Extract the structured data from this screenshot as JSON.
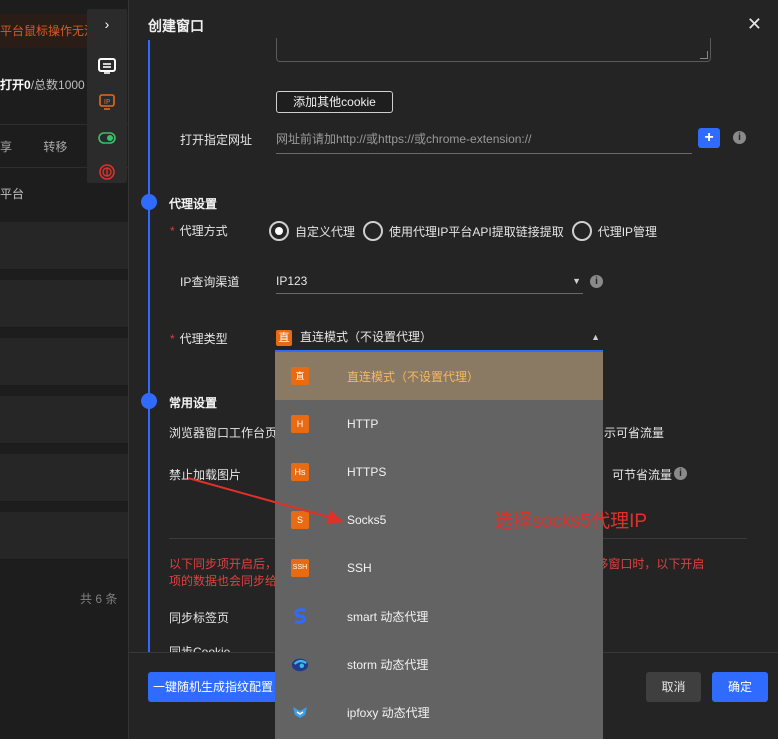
{
  "background": {
    "warning_text": "平台鼠标操作无法",
    "stats_open": "打开0",
    "stats_total": "/总数1000",
    "tabs": [
      "享",
      "转移"
    ],
    "column_head": "平台",
    "total_rows": "共 6 条"
  },
  "modal": {
    "title": "创建窗口",
    "add_cookie_button": "添加其他cookie",
    "open_url_label": "打开指定网址",
    "open_url_placeholder": "网址前请加http://或https://或chrome-extension://",
    "proxy_section_title": "代理设置",
    "proxy_mode_label": "代理方式",
    "proxy_modes": [
      "自定义代理",
      "使用代理IP平台API提取链接提取",
      "代理IP管理"
    ],
    "ip_channel_label": "IP查询渠道",
    "ip_channel_value": "IP123",
    "proxy_type_label": "代理类型",
    "proxy_type_badge": "直",
    "proxy_type_value": "直连模式（不设置代理）",
    "common_section_title": "常用设置",
    "workbench_label": "浏览器窗口工作台页",
    "workbench_suffix": "示可省流量",
    "disable_images_label": "禁止加载图片",
    "disable_images_suffix": "可节省流量",
    "warning_line1": "以下同步项开启后，",
    "warning_line1_suffix": "享/转移窗口时，以下开启",
    "warning_line2": "项的数据也会同步给",
    "sync_tabs_label": "同步标签页",
    "sync_cookie_label": "同步Cookie",
    "random_fingerprint_button": "一键随机生成指纹配置",
    "cancel_button": "取消",
    "confirm_button": "确定"
  },
  "dropdown": {
    "options": [
      {
        "icon": "直",
        "label": "直连模式（不设置代理）"
      },
      {
        "icon": "H",
        "label": "HTTP"
      },
      {
        "icon": "Hs",
        "label": "HTTPS"
      },
      {
        "icon": "S",
        "label": "Socks5"
      },
      {
        "icon": "SSH",
        "label": "SSH"
      },
      {
        "icon": "smart-icon",
        "label": "smart 动态代理"
      },
      {
        "icon": "storm-icon",
        "label": "storm 动态代理"
      },
      {
        "icon": "ipfoxy-icon",
        "label": "ipfoxy 动态代理"
      }
    ],
    "selected_index": 0
  },
  "annotation": {
    "text": "选择socks5代理IP",
    "color": "#e0302a"
  },
  "colors": {
    "accent": "#2f6bff",
    "orange": "#e86b14",
    "danger": "#e0413f"
  }
}
